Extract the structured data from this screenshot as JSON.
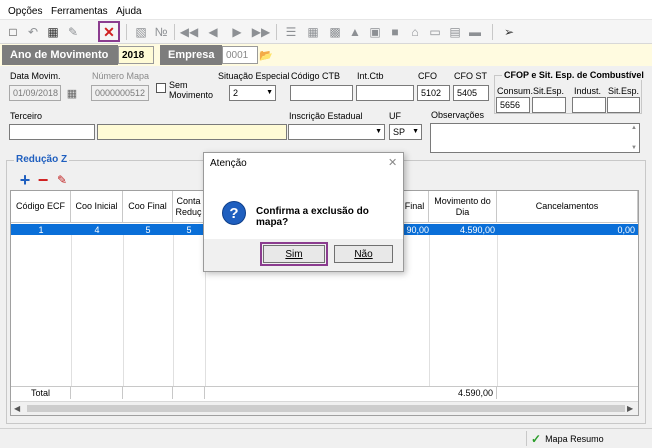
{
  "menu": {
    "items": [
      "Opções",
      "Ferramentas",
      "Ajuda"
    ]
  },
  "colors": {
    "accent": "#8b3c8f",
    "selection": "#0a6fd8",
    "header_dark": "#7d7d7d",
    "highlight_yellow": "#fffbd6",
    "section_blue": "#1f5fbf"
  },
  "header": {
    "year_label": "Ano de Movimento",
    "year_value": "2018",
    "company_label": "Empresa",
    "company_value": "0001"
  },
  "form": {
    "data_movim_label": "Data Movim.",
    "data_movim_value": "01/09/2018",
    "numero_mapa_label": "Número Mapa",
    "numero_mapa_value": "0000000512",
    "sem_movimento_label_1": "Sem",
    "sem_movimento_label_2": "Movimento",
    "situacao_label": "Situação Especial",
    "situacao_value": "2",
    "codigo_ctb_label": "Código CTB",
    "codigo_ctb_value": "",
    "int_ctb_label": "Int.Ctb",
    "int_ctb_value": "",
    "cfo_label": "CFO",
    "cfo_value": "5102",
    "cfo_st_label": "CFO ST",
    "cfo_st_value": "5405",
    "terceiro_label": "Terceiro",
    "inscricao_label": "Inscrição Estadual",
    "uf_label": "UF",
    "uf_value": "SP",
    "observacoes_label": "Observações"
  },
  "combustivel": {
    "title": "CFOP e Sit. Esp. de Combustível",
    "consum_label": "Consum.",
    "consum_value": "5656",
    "sit_esp_label_1": "Sit.Esp.",
    "indust_label": "Indust.",
    "sit_esp_label_2": "Sit.Esp."
  },
  "reducao": {
    "title": "Redução Z",
    "add_icon": "plus-icon",
    "remove_icon": "minus-icon",
    "edit_icon": "pen-icon",
    "columns": [
      "Código ECF",
      "Coo Inicial",
      "Coo Final",
      "Conta\nReduç",
      "Final",
      "Movimento do\nDia",
      "Cancelamentos"
    ],
    "rows": [
      {
        "codigo_ecf": "1",
        "coo_inicial": "4",
        "coo_final": "5",
        "conta_reduc": "5",
        "final": "90,00",
        "movimento": "4.590,00",
        "cancelamentos": "0,00"
      }
    ],
    "total_label": "Total",
    "total_movimento": "4.590,00"
  },
  "status": {
    "mapa_resumo": "Mapa Resumo"
  },
  "dialog": {
    "title": "Atenção",
    "message": "Confirma a exclusão do mapa?",
    "yes_label": "Sim",
    "no_label": "Não",
    "icon": "question-icon"
  }
}
